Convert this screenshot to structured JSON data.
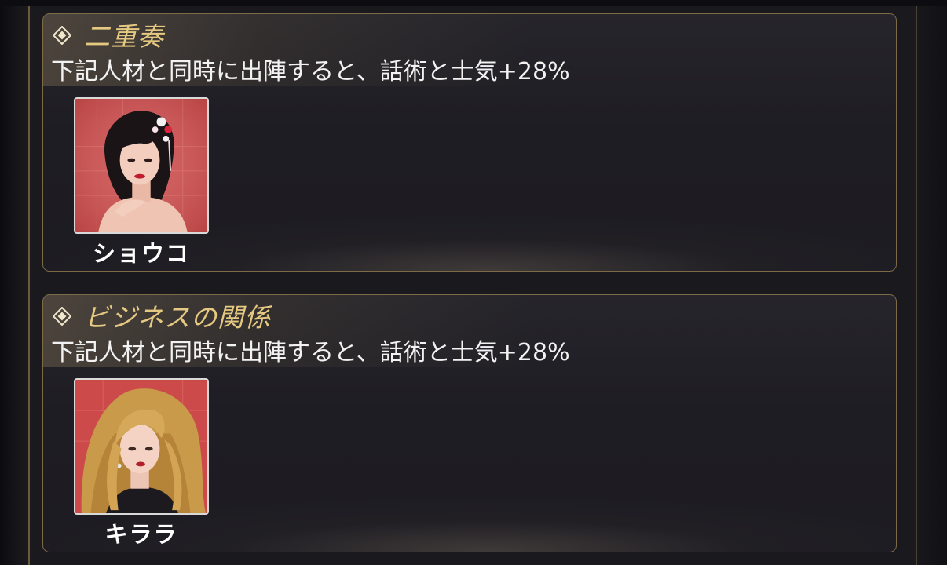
{
  "bonuses": [
    {
      "title": "二重奏",
      "description": "下記人材と同時に出陣すると、話術と士気+28%",
      "character": {
        "name": "ショウコ"
      }
    },
    {
      "title": "ビジネスの関係",
      "description": "下記人材と同時に出陣すると、話術と士気+28%",
      "character": {
        "name": "キララ"
      }
    }
  ],
  "colors": {
    "title": "#e6c981",
    "border": "#7d6b48",
    "portrait_bg": "#d45656"
  },
  "icons": [
    "diamond-bullet-icon"
  ]
}
